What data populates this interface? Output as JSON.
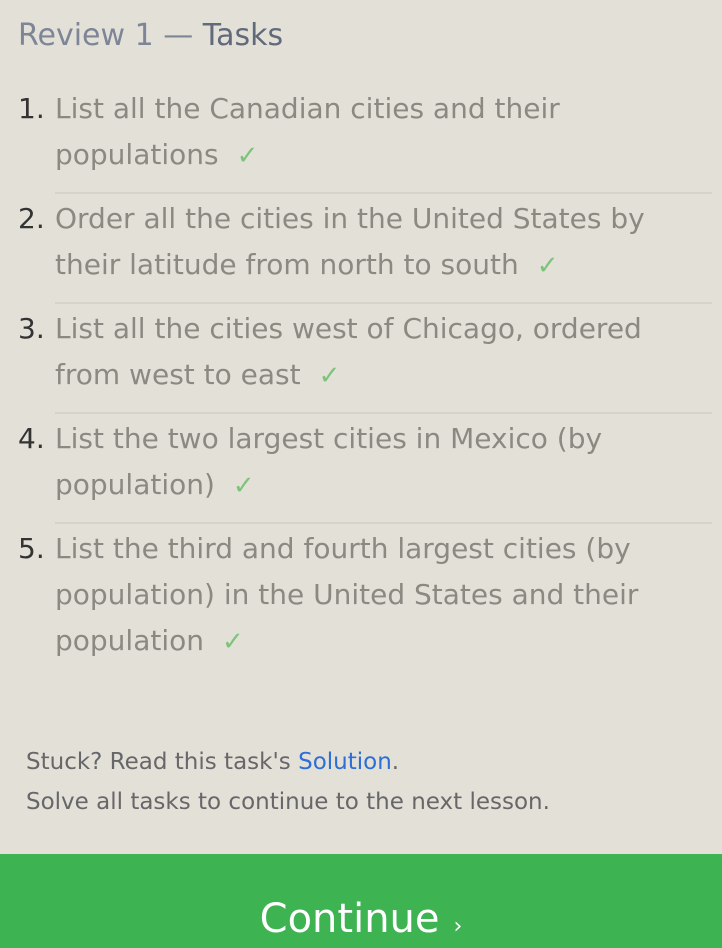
{
  "header": {
    "review": "Review 1",
    "separator": "—",
    "tasks": "Tasks"
  },
  "tasks": [
    {
      "num": "1.",
      "text": "List all the Canadian cities and their populations",
      "check": "✓"
    },
    {
      "num": "2.",
      "text": "Order all the cities in the United States by their latitude from north to south",
      "check": "✓"
    },
    {
      "num": "3.",
      "text": "List all the cities west of Chicago, ordered from west to east",
      "check": "✓"
    },
    {
      "num": "4.",
      "text": "List the two largest cities in Mexico (by population)",
      "check": "✓"
    },
    {
      "num": "5.",
      "text": "List the third and fourth largest cities (by population) in the United States and their population",
      "check": "✓"
    }
  ],
  "help": {
    "prefix": "Stuck? Read this task's ",
    "link": "Solution",
    "suffix": ".",
    "line2": "Solve all tasks to continue to the next lesson."
  },
  "continue_button": {
    "label": "Continue",
    "chevron": "›"
  },
  "colors": {
    "background": "#e3e0d8",
    "accent_green": "#3eb352",
    "check_green": "#7cc47c",
    "link_blue": "#2d6fd6"
  }
}
